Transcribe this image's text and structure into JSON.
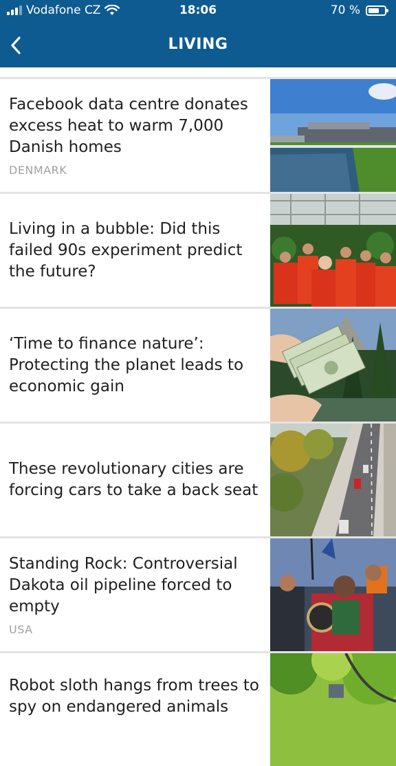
{
  "status_bar": {
    "carrier": "Vodafone CZ",
    "time": "18:06",
    "battery": "70 %",
    "battery_level": 0.7
  },
  "nav": {
    "title": "LIVING"
  },
  "articles": [
    {
      "headline": "Facebook data centre donates excess heat to warm 7,000 Danish homes",
      "tag": "DENMARK",
      "image": "data-centre-photo"
    },
    {
      "headline": "Living in a bubble: Did this failed 90s experiment predict the future?",
      "tag": "",
      "image": "biosphere-crew-photo"
    },
    {
      "headline": "‘Time to finance nature’: Protecting the planet leads to economic gain",
      "tag": "",
      "image": "money-nature-photo"
    },
    {
      "headline": "These revolutionary cities are forcing cars to take a back seat",
      "tag": "",
      "image": "city-street-photo"
    },
    {
      "headline": "Standing Rock: Controversial Dakota oil pipeline forced to empty",
      "tag": "USA",
      "image": "protest-photo"
    },
    {
      "headline": "Robot sloth hangs from trees to spy on endangered animals",
      "tag": "",
      "image": "forest-photo"
    }
  ],
  "colors": {
    "header": "#0e5b91",
    "headline": "#1f1f1f",
    "tag": "#a0a0a0",
    "divider": "#e3e3e3"
  }
}
